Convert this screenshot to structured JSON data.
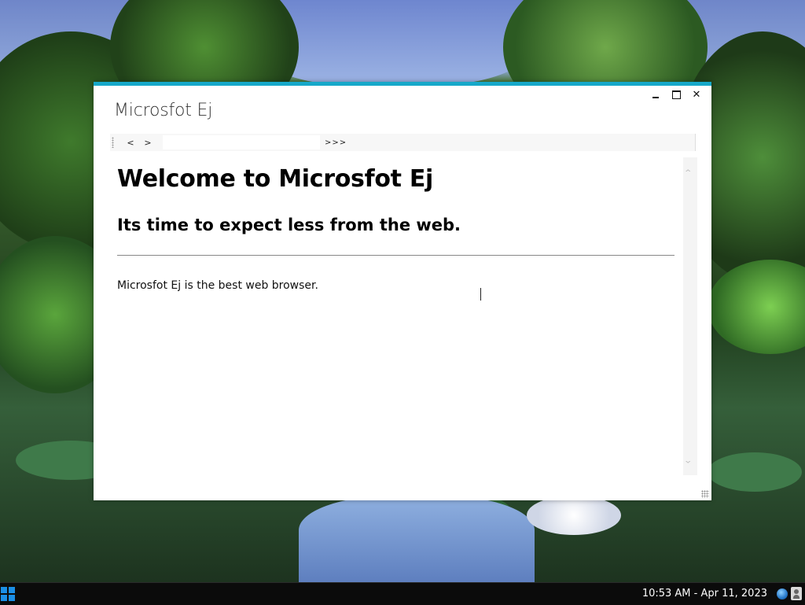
{
  "window": {
    "title": "Microsfot Ej",
    "accent_color": "#16a8c9",
    "controls": {
      "minimize_icon": "minimize-icon",
      "maximize_icon": "maximize-icon",
      "close_label": "✕"
    }
  },
  "toolbar": {
    "back_label": "<",
    "forward_label": ">",
    "address_value": "",
    "overflow_label": ">>>"
  },
  "page": {
    "heading": "Welcome to Microsfot Ej",
    "subheading": "Its time to expect less from the web.",
    "body": "Microsfot Ej is the best web browser."
  },
  "scrollbar": {
    "up_label": "^",
    "down_label": "v"
  },
  "taskbar": {
    "start_icon": "windows-start-icon",
    "clock": "10:53 AM - Apr 11, 2023",
    "tray_icons": [
      "globe-icon",
      "user-icon"
    ],
    "start_color": "#1b8fe6"
  }
}
